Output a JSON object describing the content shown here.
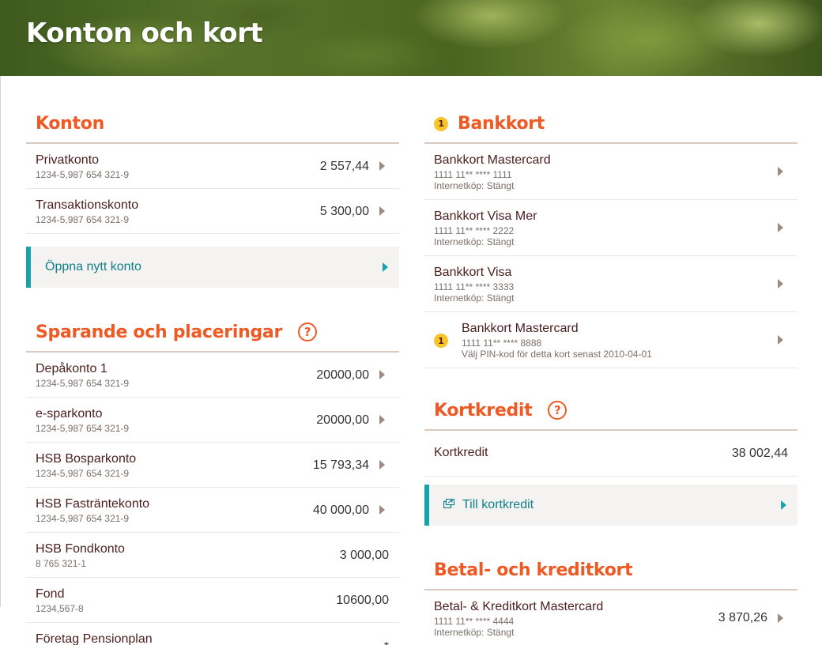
{
  "header": {
    "title": "Konton och kort"
  },
  "konton": {
    "title": "Konton",
    "accounts": [
      {
        "name": "Privatkonto",
        "number": "1234-5,987 654 321-9",
        "amount": "2 557,44"
      },
      {
        "name": "Transaktionskonto",
        "number": "1234-5,987 654 321-9",
        "amount": "5 300,00"
      }
    ],
    "open_new": "Öppna nytt konto"
  },
  "sparande": {
    "title": "Sparande och placeringar",
    "help": "?",
    "accounts": [
      {
        "name": "Depåkonto 1",
        "number": "1234-5,987 654 321-9",
        "amount": "20000,00"
      },
      {
        "name": "e-sparkonto",
        "number": "1234-5,987 654 321-9",
        "amount": "20000,00"
      },
      {
        "name": "HSB Bosparkonto",
        "number": "1234-5,987 654 321-9",
        "amount": "15 793,34"
      },
      {
        "name": "HSB Fasträntekonto",
        "number": "1234-5,987 654 321-9",
        "amount": "40 000,00"
      },
      {
        "name": "HSB Fondkonto",
        "number": "8 765 321-1",
        "amount": "3 000,00"
      },
      {
        "name": "Fond",
        "number": "1234,567-8",
        "amount": "10600,00"
      },
      {
        "name": "Företag Pensionplan",
        "number": "",
        "amount": "*"
      }
    ]
  },
  "bankkort": {
    "badge": "1",
    "title": "Bankkort",
    "cards": [
      {
        "name": "Bankkort Mastercard",
        "number": "1111 11** **** 1111",
        "info": "Internetköp: Stängt"
      },
      {
        "name": "Bankkort Visa Mer",
        "number": "1111 11** **** 2222",
        "info": "Internetköp: Stängt"
      },
      {
        "name": "Bankkort Visa",
        "number": "1111 11** **** 3333",
        "info": "Internetköp: Stängt"
      },
      {
        "name": "Bankkort Mastercard",
        "number": "1111 11** **** 8888",
        "info": "Välj PIN-kod för detta kort senast 2010-04-01",
        "badge": "1"
      }
    ]
  },
  "kortkredit": {
    "title": "Kortkredit",
    "help": "?",
    "row_name": "Kortkredit",
    "row_amount": "38 002,44",
    "action": "Till kortkredit"
  },
  "betal": {
    "title": "Betal- och kreditkort",
    "cards": [
      {
        "name": "Betal- & Kreditkort Mastercard",
        "number": "1111 11** **** 4444",
        "info": "Internetköp: Stängt",
        "amount": "3 870,26"
      }
    ]
  }
}
